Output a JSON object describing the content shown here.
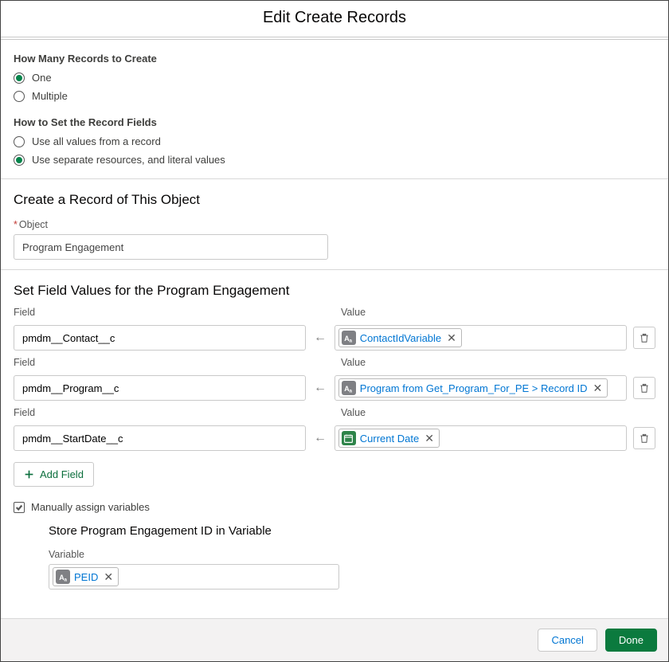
{
  "title": "Edit Create Records",
  "howMany": {
    "label": "How Many Records to Create",
    "options": {
      "one": "One",
      "multiple": "Multiple"
    },
    "selected": "one"
  },
  "howSet": {
    "label": "How to Set the Record Fields",
    "options": {
      "allValues": "Use all values from a record",
      "separate": "Use separate resources, and literal values"
    },
    "selected": "separate"
  },
  "objectSection": {
    "heading": "Create a Record of This Object",
    "label": "Object",
    "value": "Program Engagement"
  },
  "fieldsSection": {
    "heading": "Set Field Values for the Program Engagement",
    "fieldLabel": "Field",
    "valueLabel": "Value",
    "rows": [
      {
        "field": "pmdm__Contact__c",
        "valuePill": {
          "icon": "text",
          "text": "ContactIdVariable"
        }
      },
      {
        "field": "pmdm__Program__c",
        "valuePill": {
          "icon": "text",
          "text": "Program from Get_Program_For_PE > Record ID"
        }
      },
      {
        "field": "pmdm__StartDate__c",
        "valuePill": {
          "icon": "date",
          "text": "Current Date"
        }
      }
    ],
    "addButton": "Add Field"
  },
  "manualAssign": {
    "checked": true,
    "label": "Manually assign variables"
  },
  "storeVar": {
    "heading": "Store Program Engagement ID in Variable",
    "label": "Variable",
    "pill": {
      "icon": "text",
      "text": "PEID"
    }
  },
  "footer": {
    "cancel": "Cancel",
    "done": "Done"
  }
}
